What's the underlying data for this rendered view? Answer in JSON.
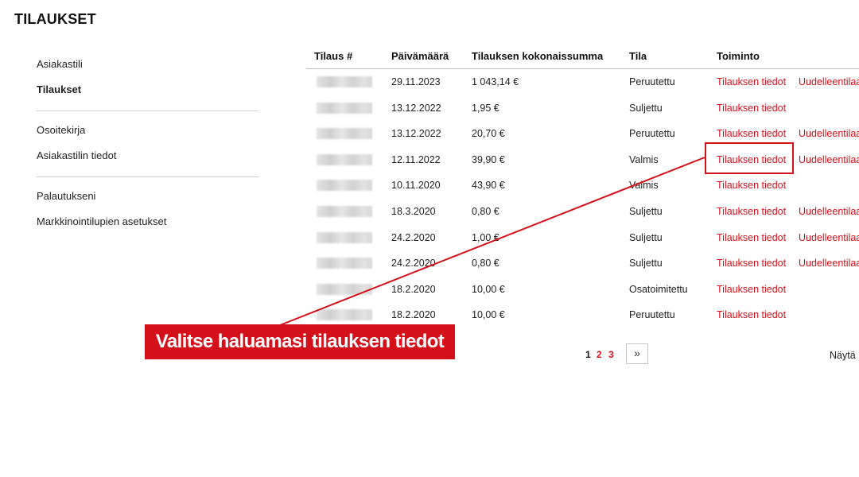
{
  "page_title": "TILAUKSET",
  "sidebar": {
    "groups": [
      [
        "Asiakastili",
        "Tilaukset"
      ],
      [
        "Osoitekirja",
        "Asiakastilin tiedot"
      ],
      [
        "Palautukseni",
        "Markkinointilupien asetukset"
      ]
    ],
    "active": "Tilaukset"
  },
  "table": {
    "headers": {
      "order": "Tilaus #",
      "date": "Päivämäärä",
      "total": "Tilauksen kokonaissumma",
      "status": "Tila",
      "action": "Toiminto"
    },
    "details_label": "Tilauksen tiedot",
    "reorder_label": "Uudelleentilaa",
    "rows": [
      {
        "date": "29.11.2023",
        "total": "1 043,14 €",
        "status": "Peruutettu",
        "reorder": true
      },
      {
        "date": "13.12.2022",
        "total": "1,95 €",
        "status": "Suljettu",
        "reorder": false
      },
      {
        "date": "13.12.2022",
        "total": "20,70 €",
        "status": "Peruutettu",
        "reorder": true
      },
      {
        "date": "12.11.2022",
        "total": "39,90 €",
        "status": "Valmis",
        "reorder": true
      },
      {
        "date": "10.11.2020",
        "total": "43,90 €",
        "status": "Valmis",
        "reorder": false
      },
      {
        "date": "18.3.2020",
        "total": "0,80 €",
        "status": "Suljettu",
        "reorder": true
      },
      {
        "date": "24.2.2020",
        "total": "1,00 €",
        "status": "Suljettu",
        "reorder": true
      },
      {
        "date": "24.2.2020",
        "total": "0,80 €",
        "status": "Suljettu",
        "reorder": true
      },
      {
        "date": "18.2.2020",
        "total": "10,00 €",
        "status": "Osatoimitettu",
        "reorder": false
      },
      {
        "date": "18.2.2020",
        "total": "10,00 €",
        "status": "Peruutettu",
        "reorder": false
      }
    ]
  },
  "callout": {
    "text": "Valitse haluamasi tilauksen tiedot",
    "color": "#d4111a"
  },
  "pagination": {
    "pages": [
      "1",
      "2",
      "3"
    ],
    "current": "1",
    "next_glyph": "»"
  },
  "show_label": "Näytä",
  "colors": {
    "accent": "#d4111a",
    "divider": "#cfcfcf"
  }
}
